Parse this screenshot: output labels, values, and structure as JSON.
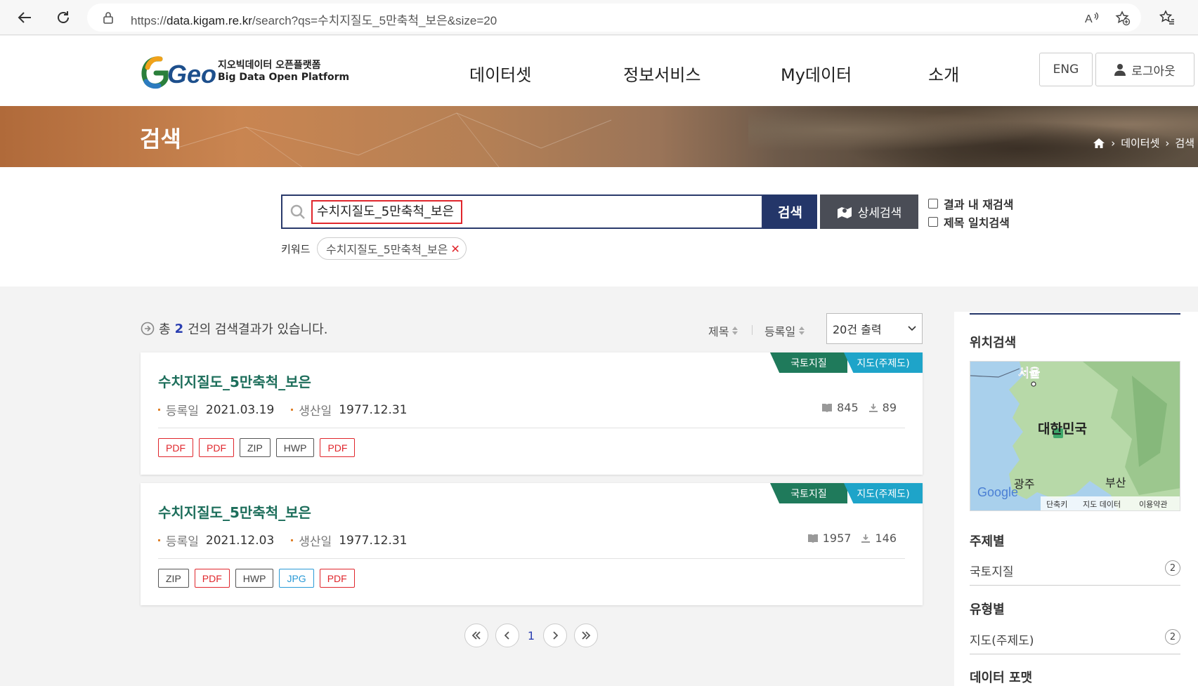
{
  "browser": {
    "url_host_prefix": "https://",
    "url_host": "data.kigam.re.kr",
    "url_path": "/search?qs=수치지질도_5만축척_보은&size=20"
  },
  "header": {
    "logo_word": "Geo",
    "logo_ko": "지오빅데이터 오픈플랫폼",
    "logo_en": "Big Data Open Platform",
    "nav": [
      "데이터셋",
      "정보서비스",
      "My데이터",
      "소개"
    ],
    "eng_label": "ENG",
    "logout_label": "로그아웃"
  },
  "banner": {
    "title": "검색",
    "breadcrumb": [
      "데이터셋",
      "검색"
    ]
  },
  "search": {
    "query": "수치지질도_5만축척_보은",
    "search_button": "검색",
    "detail_button": "상세검색",
    "check_research": "결과 내 재검색",
    "check_title": "제목 일치검색",
    "keyword_label": "키워드",
    "keyword_chip": "수치지질도_5만축척_보은"
  },
  "results": {
    "summary_prefix": "총 ",
    "count": "2",
    "summary_suffix": "건의 검색결과가 있습니다.",
    "sort_title": "제목",
    "sort_date": "등록일",
    "page_size": "20건 출력",
    "items": [
      {
        "tag1": "국토지질",
        "tag2": "지도(주제도)",
        "title": "수치지질도_5만축척_보은",
        "reg_label": "등록일",
        "reg_date": "2021.03.19",
        "prod_label": "생산일",
        "prod_date": "1977.12.31",
        "views": "845",
        "downloads": "89",
        "files": [
          "PDF",
          "PDF",
          "ZIP",
          "HWP",
          "PDF"
        ]
      },
      {
        "tag1": "국토지질",
        "tag2": "지도(주제도)",
        "title": "수치지질도_5만축척_보은",
        "reg_label": "등록일",
        "reg_date": "2021.12.03",
        "prod_label": "생산일",
        "prod_date": "1977.12.31",
        "views": "1957",
        "downloads": "146",
        "files": [
          "ZIP",
          "PDF",
          "HWP",
          "JPG",
          "PDF"
        ]
      }
    ],
    "current_page": "1"
  },
  "sidebar": {
    "location_title": "위치검색",
    "map": {
      "label_seoul": "서울",
      "label_korea": "대한민국",
      "label_gwangju": "광주",
      "label_busan": "부산",
      "google": "Google",
      "shortcut": "단축키",
      "map_data": "지도 데이터",
      "terms": "이용약관"
    },
    "theme_title": "주제별",
    "theme_item": "국토지질",
    "theme_count": "2",
    "type_title": "유형별",
    "type_item": "지도(주제도)",
    "type_count": "2",
    "format_title": "데이터 포맷"
  }
}
